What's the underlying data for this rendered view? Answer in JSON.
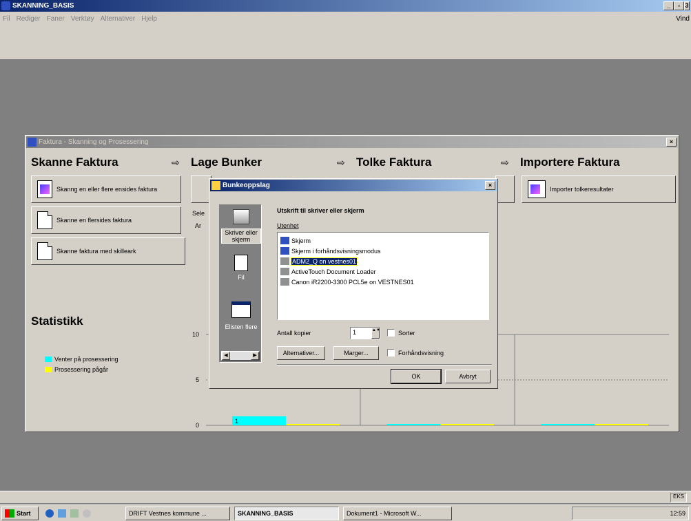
{
  "app": {
    "title": "SKANNING_BASIS",
    "menu": [
      "Fil",
      "Rediger",
      "Faner",
      "Verktøy",
      "Alternativer",
      "Hjelp"
    ],
    "right_label": "Vind"
  },
  "faktura_window": {
    "title": "Faktura - Skanning og Prosessering",
    "sections": {
      "skanne": "Skanne Faktura",
      "bunker": "Lage Bunker",
      "tolke": "Tolke Faktura",
      "importere": "Importere Faktura"
    },
    "arrow_glyph": "⇨",
    "buttons": {
      "scan_multi": "Skanng en eller flere ensides faktura",
      "scan_multipage": "Skanne en flersides faktura",
      "scan_separator": "Skanne faktura med skilleark",
      "import_results": "Importer tolkeresultater"
    },
    "partial_label_1": "Sele",
    "partial_label_2": "Ar",
    "statistics_title": "Statistikk",
    "legend": [
      {
        "label": "Venter på prosessering",
        "color": "#00ffff"
      },
      {
        "label": "Prosessering pågår",
        "color": "#ffff00"
      }
    ],
    "chart_data": {
      "type": "bar",
      "ylim": [
        0,
        10
      ],
      "ticks": [
        "10",
        "5",
        "0"
      ],
      "series": [
        {
          "name": "Venter på prosessering",
          "values": [
            1,
            0,
            0
          ]
        },
        {
          "name": "Prosessering pågår",
          "values": [
            0,
            0,
            0
          ]
        }
      ],
      "data_labels": [
        "1"
      ],
      "colors": [
        "#00ffff",
        "#ffff00"
      ]
    }
  },
  "dialog": {
    "title": "Bunkeoppslag",
    "sidebar": [
      {
        "label": "Skriver eller skjerm",
        "icon": "printer-icon"
      },
      {
        "label": "Fil",
        "icon": "file-icon"
      },
      {
        "label": "Elisten flere",
        "icon": "window-icon"
      }
    ],
    "heading": "Utskrift til skriver eller skjerm",
    "device_label": "Utenhet",
    "devices": [
      "Skjerm",
      "Skjerm i forhåndsvisningsmodus",
      "ADM2_Q on vestnes01",
      "ActiveTouch Document Loader",
      "Canon iR2200-3300 PCL5e on VESTNES01"
    ],
    "selected_device_index": 2,
    "copies_label": "Antall kopier",
    "copies_value": "1",
    "sort_label": "Sorter",
    "options_button": "Alternativer...",
    "margins_button": "Marger...",
    "preview_label": "Forhåndsvisning",
    "ok_button": "OK",
    "cancel_button": "Avbryt"
  },
  "statusbar": {
    "right_text": "EKS"
  },
  "taskbar": {
    "start": "Start",
    "tasks": [
      "DRIFT Vestnes kommune ...",
      "SKANNING_BASIS",
      "Dokument1 - Microsoft W..."
    ],
    "clock": "12:59"
  }
}
